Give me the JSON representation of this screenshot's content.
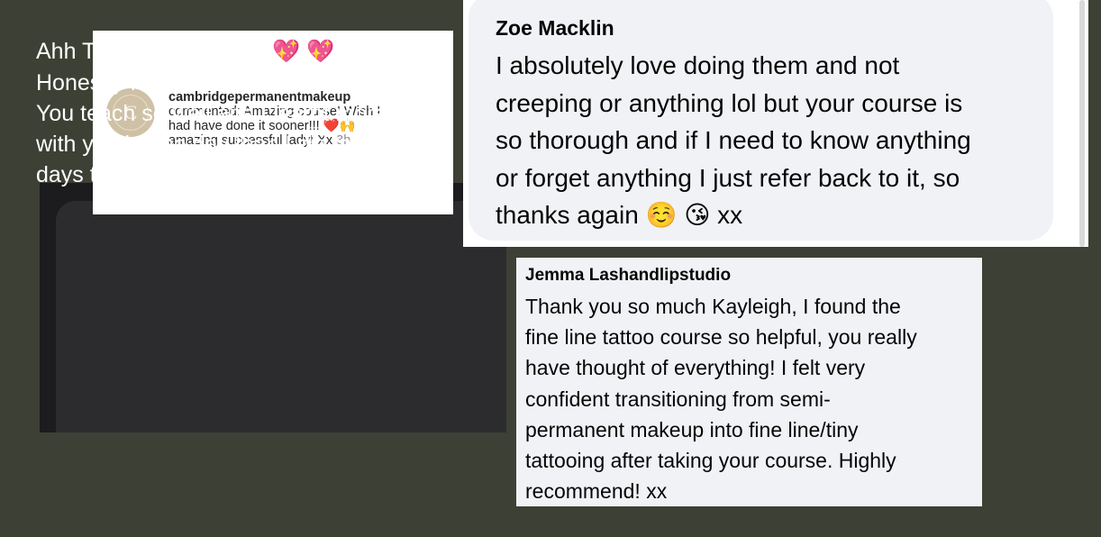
{
  "instagram_comment": {
    "avatar_letter": "C",
    "username": "cambridgepermanentmakeup",
    "lines": [
      "commented: Amazing course! Wish I",
      "had have done it sooner!!! ❤️🙌",
      "amazing successful lady! Xx"
    ],
    "time": "3h"
  },
  "dark_message": {
    "lines": [
      "Ahh Thankyou so much💖 💖",
      "Honestly I learnt so much!!",
      "You teach so well and I learnt more",
      "with you in one day than I did in 2",
      "days to get original qualification!!😅"
    ]
  },
  "zoe_comment": {
    "name": "Zoe Macklin",
    "lines": [
      "I absolutely love doing them and not",
      "creeping or anything lol but your course is",
      "so thorough and if I need to know anything",
      "or forget anything  I just refer back to it, so",
      "thanks again ☺️ 😘 xx"
    ]
  },
  "jemma_comment": {
    "name": "Jemma Lashandlipstudio",
    "lines": [
      "Thank you so much Kayleigh, I found the",
      "fine line tattoo course so helpful, you really",
      "have thought of everything! I felt very",
      "confident transitioning from semi-",
      "permanent makeup into fine line/tiny",
      "tattooing after taking your course. Highly",
      "recommend! xx"
    ]
  }
}
